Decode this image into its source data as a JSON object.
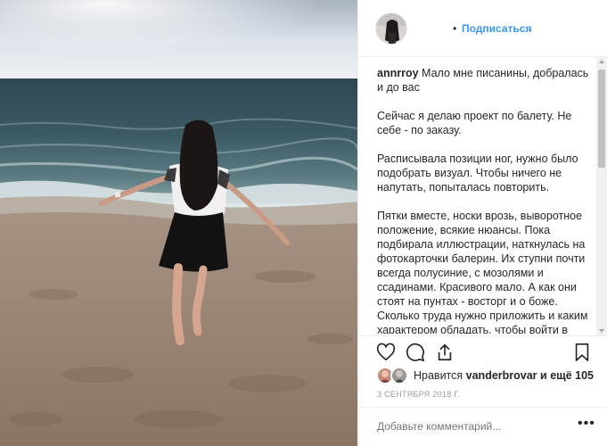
{
  "post": {
    "image_alt": "Девушка на пляже у моря",
    "header": {
      "separator": "•",
      "follow_label": "Подписаться"
    },
    "caption": {
      "username": "annrroy",
      "paragraphs": [
        "Мало мне писанины, добралась и до вас",
        "Сейчас я делаю проект по балету. Не себе - по заказу.",
        "Расписывала позиции ног, нужно было подобрать визуал. Чтобы ничего не напутать, попыталась повторить.",
        "Пятки вместе, носки врозь, выворотное положение, всякие нюансы. Пока подбирала иллюстрации, наткнулась на фотокарточки балерин. Их ступни почти всегда полусиние, с мозолями и ссадинами. Красивого мало. А как они стоят на пунтах - восторг и о боже. Сколько труда нужно приложить и каким характером обладать, чтобы войти в большой балет."
      ]
    },
    "actions": {
      "like_icon": "heart-icon",
      "comment_icon": "speech-bubble-icon",
      "share_icon": "share-icon",
      "save_icon": "bookmark-icon"
    },
    "likes": {
      "prefix": "Нравится",
      "liker": "vanderbrovar",
      "suffix": "и ещё 105"
    },
    "date": "3 СЕНТЯБРЯ 2018 Г.",
    "comment": {
      "placeholder": "Добавьте комментарий...",
      "more_label": "•••"
    },
    "colors": {
      "accent": "#3897f0",
      "text": "#262626",
      "muted": "#999999",
      "border": "#efefef"
    }
  }
}
